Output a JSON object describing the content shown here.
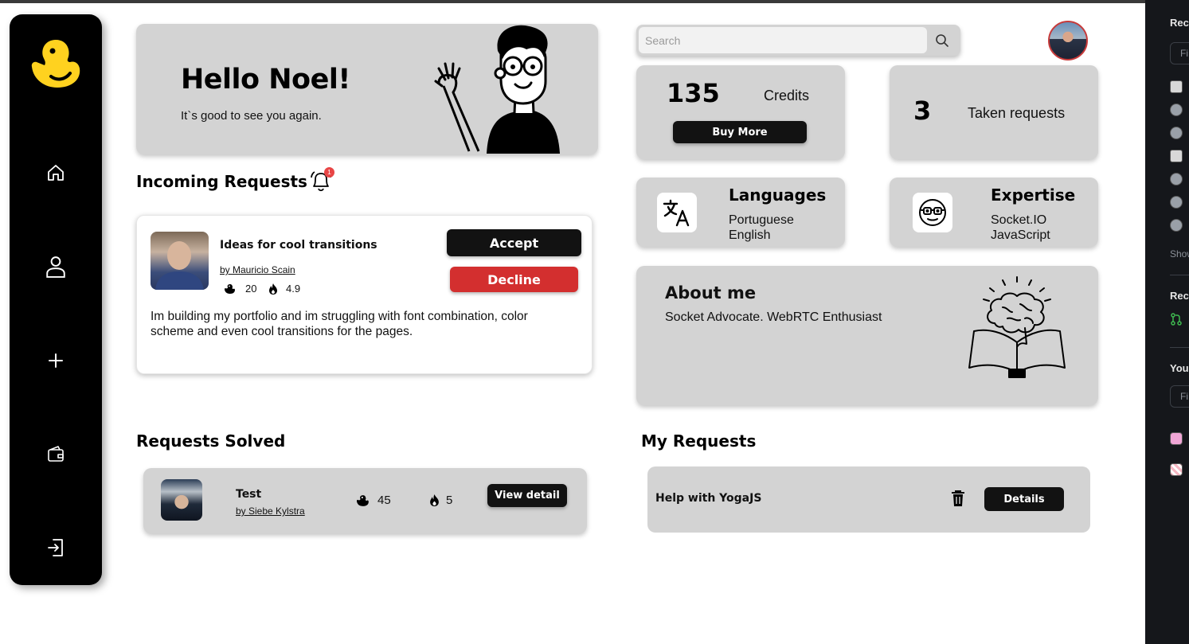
{
  "welcome": {
    "title": "Hello Noel!",
    "subtitle": "It`s good to see you again."
  },
  "incoming": {
    "heading": "Incoming Requests",
    "notification_count": "1",
    "request": {
      "title": "Ideas for cool transitions",
      "author": "by Mauricio Scain",
      "ducks": "20",
      "rating": "4.9",
      "description": "Im building my portfolio and im struggling with font combination, color scheme and even cool transitions for the pages.",
      "accept_label": "Accept",
      "decline_label": "Decline"
    }
  },
  "search": {
    "placeholder": "Search"
  },
  "stats": {
    "credits_value": "135",
    "credits_label": "Credits",
    "buy_label": "Buy More",
    "taken_value": "3",
    "taken_label": "Taken requests"
  },
  "languages": {
    "title": "Languages",
    "items": [
      "Portuguese",
      "English"
    ]
  },
  "expertise": {
    "title": "Expertise",
    "items": [
      "Socket.IO",
      "JavaScript"
    ]
  },
  "about": {
    "title": "About me",
    "text": "Socket Advocate. WebRTC Enthusiast"
  },
  "solved": {
    "heading": "Requests Solved",
    "items": [
      {
        "title": "Test",
        "author": "by Siebe Kylstra",
        "ducks": "45",
        "rating": "5",
        "button": "View detail"
      }
    ]
  },
  "my_requests": {
    "heading": "My Requests",
    "items": [
      {
        "title": "Help with YogaJS",
        "button": "Details"
      }
    ]
  },
  "right_panel": {
    "section1_title": "Rec",
    "filter1": "Fi",
    "show": "Show",
    "section2_title": "Rec",
    "section3_title": "You",
    "filter2": "Fi"
  },
  "colors": {
    "card_bg": "#d3d3d3",
    "accent_dark": "#121212",
    "decline_red": "#d32f2f",
    "duck_yellow": "#ffd21f"
  },
  "icons": {
    "nav": [
      "home-icon",
      "user-icon",
      "plus-icon",
      "wallet-icon",
      "logout-icon"
    ]
  }
}
